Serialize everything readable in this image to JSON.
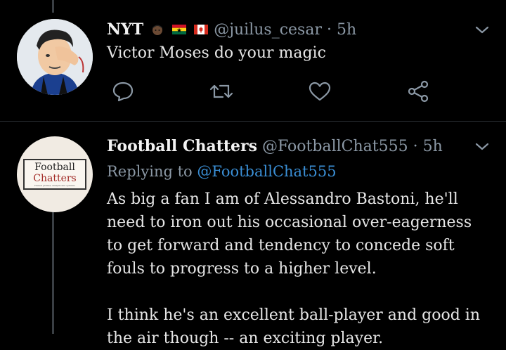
{
  "tweets": [
    {
      "display_name": "NYT",
      "flag_emojis": [
        "man-dark-skin-icon",
        "ghana-flag-icon",
        "canada-flag-icon"
      ],
      "handle": "@juilus_cesar",
      "separator": "·",
      "time": "5h",
      "text": "Victor Moses do your magic"
    },
    {
      "display_name": "Football Chatters",
      "handle": "@FootballChat555",
      "separator": "·",
      "time": "5h",
      "replying_prefix": "Replying to",
      "replying_to": "@FootballChat555",
      "paragraphs": [
        "As big a fan I am of Alessandro Bastoni, he'll need to iron out his occasional over-eagerness to get forward and tendency to concede soft fouls to progress to a higher level.",
        "I think he's an excellent ball-player and good in the air though -- an exciting player."
      ],
      "avatar_text": {
        "line1": "Football",
        "line2": "Chatters",
        "tagline": "Honest profiles, analysis and opinions"
      }
    }
  ],
  "actions": [
    "reply-icon",
    "retweet-icon",
    "like-icon",
    "share-icon"
  ],
  "colors": {
    "background": "#000000",
    "muted": "#8b98a5",
    "link": "#3a8fd6",
    "thread_line": "#3a3f44"
  }
}
